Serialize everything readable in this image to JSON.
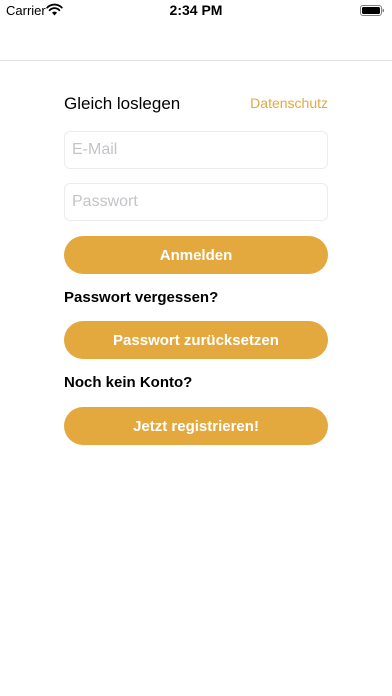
{
  "status_bar": {
    "carrier": "Carrier",
    "time": "2:34 PM"
  },
  "login": {
    "title": "Gleich loslegen",
    "privacy_link": "Datenschutz",
    "email_placeholder": "E-Mail",
    "password_placeholder": "Passwort",
    "login_button": "Anmelden",
    "forgot_label": "Passwort vergessen?",
    "reset_button": "Passwort zurücksetzen",
    "no_account_label": "Noch kein Konto?",
    "register_button": "Jetzt registrieren!"
  },
  "colors": {
    "accent": "#e3a93f",
    "background": "#ffffff"
  },
  "icons": [
    "wifi-icon",
    "battery-icon"
  ]
}
